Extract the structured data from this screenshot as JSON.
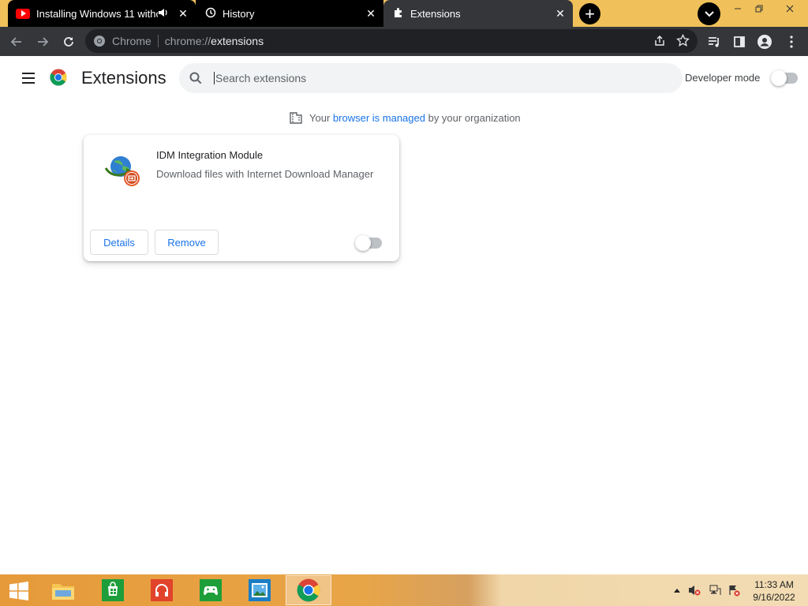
{
  "tabs": [
    {
      "title": "Installing Windows 11 witho",
      "icon": "youtube-icon",
      "audio": true
    },
    {
      "title": "History",
      "icon": "history-icon"
    },
    {
      "title": "Extensions",
      "icon": "puzzle-icon",
      "active": true
    }
  ],
  "omnibox": {
    "chip": "Chrome",
    "scheme": "chrome://",
    "host": "extensions"
  },
  "header": {
    "title": "Extensions",
    "search_placeholder": "Search extensions",
    "developer_mode_label": "Developer mode",
    "developer_mode_on": false
  },
  "managed_notice": {
    "prefix": "Your",
    "link": "browser is managed",
    "suffix": "by your organization"
  },
  "extensions": [
    {
      "name": "IDM Integration Module",
      "description": "Download files with Internet Download Manager",
      "details_label": "Details",
      "remove_label": "Remove",
      "enabled": false
    }
  ],
  "taskbar": {
    "apps": [
      "file-explorer-icon",
      "store-icon",
      "music-icon",
      "xbox-games-icon",
      "photos-icon",
      "chrome-icon"
    ],
    "time": "11:33 AM",
    "date": "9/16/2022"
  },
  "colors": {
    "accent": "#1a73e8",
    "tabstrip": "#f0c05a",
    "toolbar": "#35363a"
  }
}
